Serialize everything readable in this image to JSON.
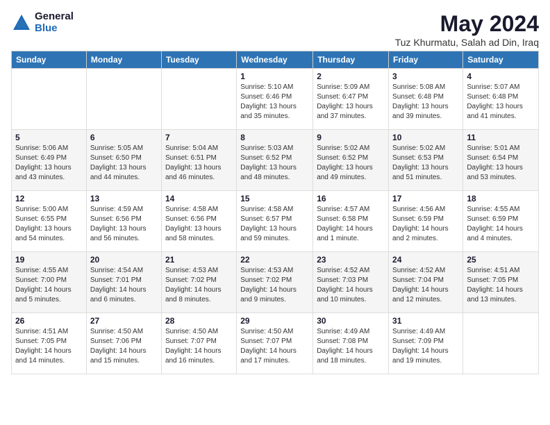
{
  "logo": {
    "general": "General",
    "blue": "Blue"
  },
  "title": {
    "month_year": "May 2024",
    "location": "Tuz Khurmatu, Salah ad Din, Iraq"
  },
  "headers": [
    "Sunday",
    "Monday",
    "Tuesday",
    "Wednesday",
    "Thursday",
    "Friday",
    "Saturday"
  ],
  "weeks": [
    [
      {
        "day": "",
        "info": ""
      },
      {
        "day": "",
        "info": ""
      },
      {
        "day": "",
        "info": ""
      },
      {
        "day": "1",
        "info": "Sunrise: 5:10 AM\nSunset: 6:46 PM\nDaylight: 13 hours\nand 35 minutes."
      },
      {
        "day": "2",
        "info": "Sunrise: 5:09 AM\nSunset: 6:47 PM\nDaylight: 13 hours\nand 37 minutes."
      },
      {
        "day": "3",
        "info": "Sunrise: 5:08 AM\nSunset: 6:48 PM\nDaylight: 13 hours\nand 39 minutes."
      },
      {
        "day": "4",
        "info": "Sunrise: 5:07 AM\nSunset: 6:48 PM\nDaylight: 13 hours\nand 41 minutes."
      }
    ],
    [
      {
        "day": "5",
        "info": "Sunrise: 5:06 AM\nSunset: 6:49 PM\nDaylight: 13 hours\nand 43 minutes."
      },
      {
        "day": "6",
        "info": "Sunrise: 5:05 AM\nSunset: 6:50 PM\nDaylight: 13 hours\nand 44 minutes."
      },
      {
        "day": "7",
        "info": "Sunrise: 5:04 AM\nSunset: 6:51 PM\nDaylight: 13 hours\nand 46 minutes."
      },
      {
        "day": "8",
        "info": "Sunrise: 5:03 AM\nSunset: 6:52 PM\nDaylight: 13 hours\nand 48 minutes."
      },
      {
        "day": "9",
        "info": "Sunrise: 5:02 AM\nSunset: 6:52 PM\nDaylight: 13 hours\nand 49 minutes."
      },
      {
        "day": "10",
        "info": "Sunrise: 5:02 AM\nSunset: 6:53 PM\nDaylight: 13 hours\nand 51 minutes."
      },
      {
        "day": "11",
        "info": "Sunrise: 5:01 AM\nSunset: 6:54 PM\nDaylight: 13 hours\nand 53 minutes."
      }
    ],
    [
      {
        "day": "12",
        "info": "Sunrise: 5:00 AM\nSunset: 6:55 PM\nDaylight: 13 hours\nand 54 minutes."
      },
      {
        "day": "13",
        "info": "Sunrise: 4:59 AM\nSunset: 6:56 PM\nDaylight: 13 hours\nand 56 minutes."
      },
      {
        "day": "14",
        "info": "Sunrise: 4:58 AM\nSunset: 6:56 PM\nDaylight: 13 hours\nand 58 minutes."
      },
      {
        "day": "15",
        "info": "Sunrise: 4:58 AM\nSunset: 6:57 PM\nDaylight: 13 hours\nand 59 minutes."
      },
      {
        "day": "16",
        "info": "Sunrise: 4:57 AM\nSunset: 6:58 PM\nDaylight: 14 hours\nand 1 minute."
      },
      {
        "day": "17",
        "info": "Sunrise: 4:56 AM\nSunset: 6:59 PM\nDaylight: 14 hours\nand 2 minutes."
      },
      {
        "day": "18",
        "info": "Sunrise: 4:55 AM\nSunset: 6:59 PM\nDaylight: 14 hours\nand 4 minutes."
      }
    ],
    [
      {
        "day": "19",
        "info": "Sunrise: 4:55 AM\nSunset: 7:00 PM\nDaylight: 14 hours\nand 5 minutes."
      },
      {
        "day": "20",
        "info": "Sunrise: 4:54 AM\nSunset: 7:01 PM\nDaylight: 14 hours\nand 6 minutes."
      },
      {
        "day": "21",
        "info": "Sunrise: 4:53 AM\nSunset: 7:02 PM\nDaylight: 14 hours\nand 8 minutes."
      },
      {
        "day": "22",
        "info": "Sunrise: 4:53 AM\nSunset: 7:02 PM\nDaylight: 14 hours\nand 9 minutes."
      },
      {
        "day": "23",
        "info": "Sunrise: 4:52 AM\nSunset: 7:03 PM\nDaylight: 14 hours\nand 10 minutes."
      },
      {
        "day": "24",
        "info": "Sunrise: 4:52 AM\nSunset: 7:04 PM\nDaylight: 14 hours\nand 12 minutes."
      },
      {
        "day": "25",
        "info": "Sunrise: 4:51 AM\nSunset: 7:05 PM\nDaylight: 14 hours\nand 13 minutes."
      }
    ],
    [
      {
        "day": "26",
        "info": "Sunrise: 4:51 AM\nSunset: 7:05 PM\nDaylight: 14 hours\nand 14 minutes."
      },
      {
        "day": "27",
        "info": "Sunrise: 4:50 AM\nSunset: 7:06 PM\nDaylight: 14 hours\nand 15 minutes."
      },
      {
        "day": "28",
        "info": "Sunrise: 4:50 AM\nSunset: 7:07 PM\nDaylight: 14 hours\nand 16 minutes."
      },
      {
        "day": "29",
        "info": "Sunrise: 4:50 AM\nSunset: 7:07 PM\nDaylight: 14 hours\nand 17 minutes."
      },
      {
        "day": "30",
        "info": "Sunrise: 4:49 AM\nSunset: 7:08 PM\nDaylight: 14 hours\nand 18 minutes."
      },
      {
        "day": "31",
        "info": "Sunrise: 4:49 AM\nSunset: 7:09 PM\nDaylight: 14 hours\nand 19 minutes."
      },
      {
        "day": "",
        "info": ""
      }
    ]
  ]
}
